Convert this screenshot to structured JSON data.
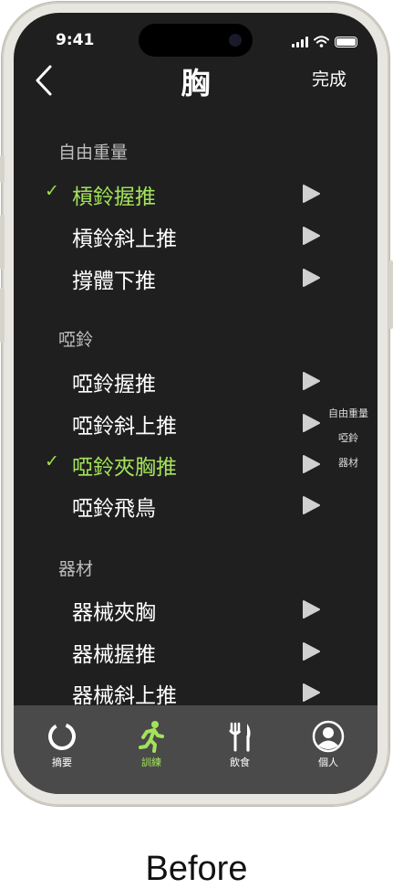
{
  "status_bar": {
    "time": "9:41"
  },
  "nav": {
    "title": "胸",
    "done_label": "完成"
  },
  "sections": [
    {
      "header": "自由重量",
      "items": [
        {
          "label": "槓鈴握推",
          "selected": true
        },
        {
          "label": "槓鈴斜上推",
          "selected": false
        },
        {
          "label": "撐體下推",
          "selected": false
        }
      ]
    },
    {
      "header": "啞鈴",
      "items": [
        {
          "label": "啞鈴握推",
          "selected": false
        },
        {
          "label": "啞鈴斜上推",
          "selected": false
        },
        {
          "label": "啞鈴夾胸推",
          "selected": true
        },
        {
          "label": "啞鈴飛鳥",
          "selected": false
        }
      ]
    },
    {
      "header": "器材",
      "items": [
        {
          "label": "器械夾胸",
          "selected": false
        },
        {
          "label": "器械握推",
          "selected": false
        },
        {
          "label": "器械斜上推",
          "selected": false
        }
      ]
    }
  ],
  "section_index": [
    "自由重量",
    "啞鈴",
    "器材"
  ],
  "tabs": [
    {
      "label": "摘要",
      "icon": "ring-icon",
      "active": false
    },
    {
      "label": "訓練",
      "icon": "running-figure-icon",
      "active": true
    },
    {
      "label": "飲食",
      "icon": "fork-knife-icon",
      "active": false
    },
    {
      "label": "個人",
      "icon": "person-circle-icon",
      "active": false
    }
  ],
  "colors": {
    "accent": "#a3e35a",
    "background": "#1f1f1f",
    "tab_bar": "#4a4a4a"
  },
  "caption": "Before"
}
